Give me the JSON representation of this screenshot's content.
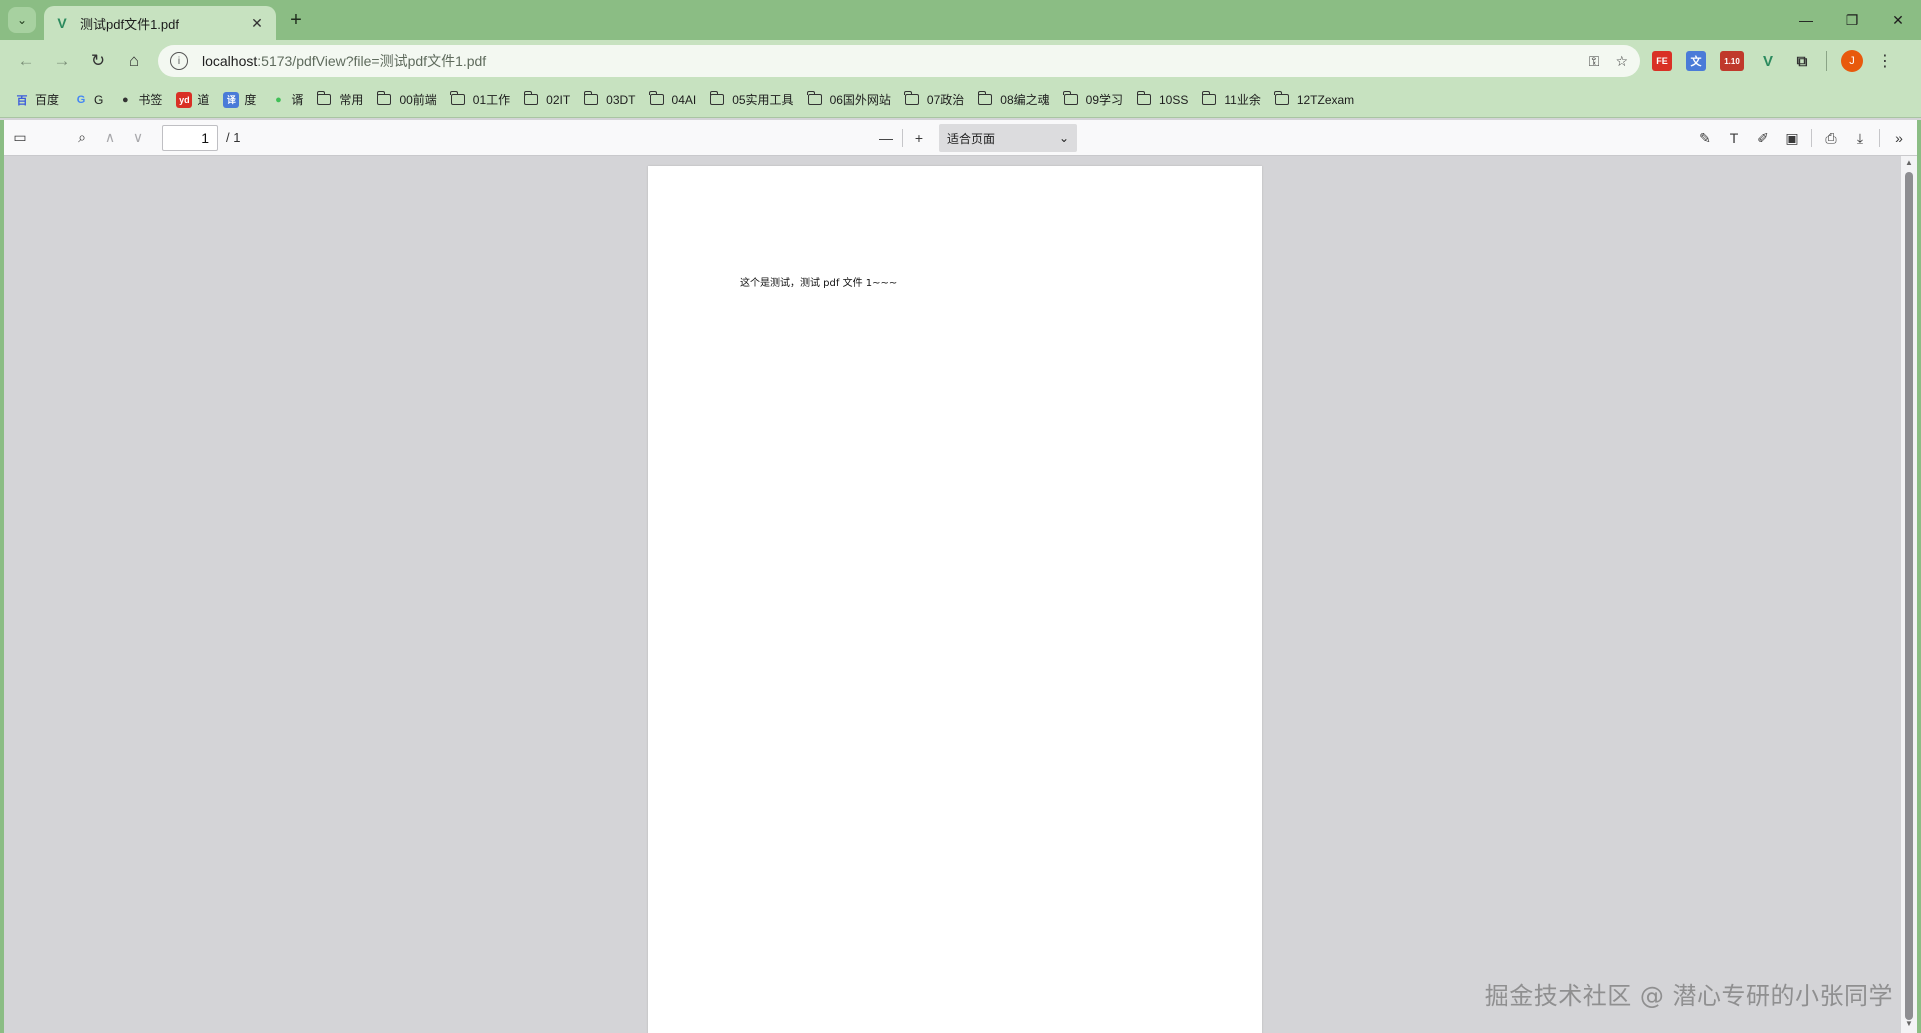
{
  "tab": {
    "title": "测试pdf文件1.pdf",
    "close_glyph": "✕",
    "new_glyph": "+",
    "search_glyph": "⌄"
  },
  "window": {
    "minimize": "—",
    "restore": "❐",
    "close": "✕"
  },
  "toolbar": {
    "url_host": "localhost",
    "url_path": ":5173/pdfView?file=测试pdf文件1.pdf",
    "extensions": [
      {
        "name": "fe-helper-icon",
        "label": "FE"
      },
      {
        "name": "translate-icon",
        "label": "文"
      },
      {
        "name": "badge-extension-icon",
        "label": "1.10"
      },
      {
        "name": "vue-devtools-icon",
        "label": "V"
      }
    ],
    "avatar_initial": "J"
  },
  "bookmarks": [
    {
      "label": "百度",
      "type": "site",
      "icon": "百"
    },
    {
      "label": "G",
      "type": "site",
      "icon": "G"
    },
    {
      "label": "书签",
      "type": "site",
      "icon": "●"
    },
    {
      "label": "道",
      "type": "site",
      "icon": "yd"
    },
    {
      "label": "度",
      "type": "site",
      "icon": "译"
    },
    {
      "label": "谞",
      "type": "site",
      "icon": "●"
    },
    {
      "label": "常用",
      "type": "folder"
    },
    {
      "label": "00前端",
      "type": "folder"
    },
    {
      "label": "01工作",
      "type": "folder"
    },
    {
      "label": "02IT",
      "type": "folder"
    },
    {
      "label": "03DT",
      "type": "folder"
    },
    {
      "label": "04AI",
      "type": "folder"
    },
    {
      "label": "05实用工具",
      "type": "folder"
    },
    {
      "label": "06国外网站",
      "type": "folder"
    },
    {
      "label": "07政治",
      "type": "folder"
    },
    {
      "label": "08编之魂",
      "type": "folder"
    },
    {
      "label": "09学习",
      "type": "folder"
    },
    {
      "label": "10SS",
      "type": "folder"
    },
    {
      "label": "11业余",
      "type": "folder"
    },
    {
      "label": "12TZexam",
      "type": "folder"
    }
  ],
  "pdf": {
    "current_page": "1",
    "page_count": "/ 1",
    "zoom_label": "适合页面",
    "page_text": "这个是测试，测试 pdf 文件 1~~~"
  },
  "watermark": "掘金技术社区 @ 潜心专研的小张同学",
  "colors": {
    "frame": "#8bbd84",
    "toolbar": "#c7e2c0",
    "viewer_bg": "#d4d4d7"
  }
}
